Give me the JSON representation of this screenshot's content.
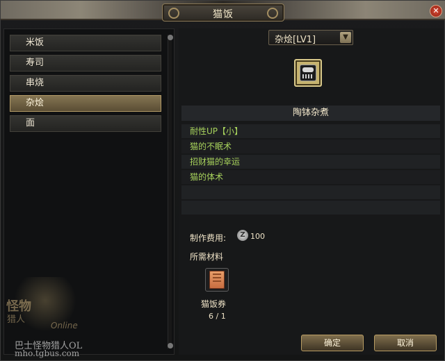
{
  "window": {
    "title": "猫饭",
    "close_icon": "close-icon"
  },
  "left_panel": {
    "items": [
      {
        "label": "米饭",
        "selected": false
      },
      {
        "label": "寿司",
        "selected": false
      },
      {
        "label": "串烧",
        "selected": false
      },
      {
        "label": "杂烩",
        "selected": true
      },
      {
        "label": "面",
        "selected": false
      }
    ]
  },
  "right_panel": {
    "dropdown": {
      "value": "杂烩[LV1]"
    },
    "dish_name": "陶钵杂煮",
    "effects": [
      "耐性UP【小】",
      "猫的不眠术",
      "招财猫的幸运",
      "猫的体术"
    ],
    "cost": {
      "label": "制作费用:",
      "value": "100"
    },
    "materials": {
      "label": "所需材料",
      "items": [
        {
          "name": "猫饭券",
          "count": "6 / 1"
        }
      ]
    },
    "buttons": {
      "confirm": "确定",
      "cancel": "取消"
    }
  },
  "logo": {
    "text1": "怪物",
    "text2": "猎人",
    "online": "Online",
    "watermark1": "巴士怪物猎人OL",
    "watermark2": "mho.tgbus.com"
  },
  "colors": {
    "accent_green": "#a8d35c",
    "selected_item": "#857552"
  }
}
